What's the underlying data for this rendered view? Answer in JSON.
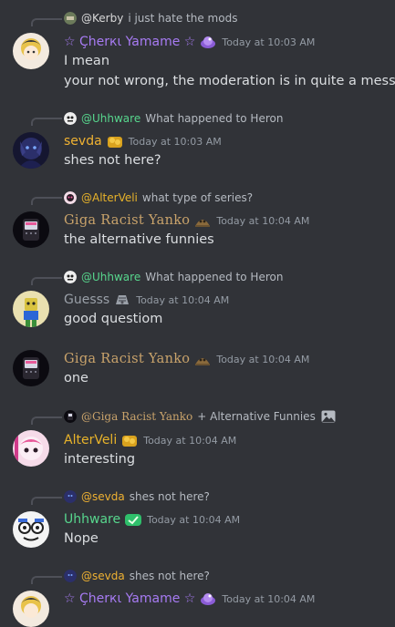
{
  "colors": {
    "background": "#313338",
    "text": "#dbdee1",
    "muted": "#949ba4",
    "reply_text": "#b5bac1",
    "purple_name": "#a77bf3",
    "orange_name": "#f0b232",
    "tan_name": "#c9a36b",
    "gray_name": "#9aa0a8",
    "green_name": "#57d68d",
    "yellow_name": "#e8b32a"
  },
  "messages": [
    {
      "reply": {
        "name": "@Kerby",
        "text": "i just hate the mods"
      },
      "author": "☆ Çherкι Yamame ☆",
      "timestamp": "Today at 10:03 AM",
      "lines": [
        "I mean",
        "your not wrong, the moderation is in quite a mess"
      ]
    },
    {
      "reply": {
        "name": "@Uhhware",
        "text": "What happened to Heron"
      },
      "author": "sevda",
      "timestamp": "Today at 10:03 AM",
      "lines": [
        "shes not here?"
      ]
    },
    {
      "reply": {
        "name": "@AlterVeli",
        "text": "what type of series?"
      },
      "author": "Giga Racist Yanko",
      "timestamp": "Today at 10:04 AM",
      "lines": [
        "the alternative funnies"
      ]
    },
    {
      "reply": {
        "name": "@Uhhware",
        "text": "What happened to Heron"
      },
      "author": "Guesss",
      "timestamp": "Today at 10:04 AM",
      "lines": [
        "good questiom"
      ]
    },
    {
      "author": "Giga Racist Yanko",
      "timestamp": "Today at 10:04 AM",
      "lines": [
        "one"
      ]
    },
    {
      "reply": {
        "name": "@Giga Racist Yanko",
        "text": "+ Alternative Funnies"
      },
      "author": "AlterVeli",
      "timestamp": "Today at 10:04 AM",
      "lines": [
        "interesting"
      ]
    },
    {
      "reply": {
        "name": "@sevda",
        "text": "shes not here?"
      },
      "author": "Uhhware",
      "timestamp": "Today at 10:04 AM",
      "lines": [
        "Nope"
      ]
    },
    {
      "reply": {
        "name": "@sevda",
        "text": "shes not here?"
      },
      "author": "☆ Çherкι Yamame ☆",
      "timestamp": "Today at 10:04 AM",
      "lines": []
    }
  ]
}
